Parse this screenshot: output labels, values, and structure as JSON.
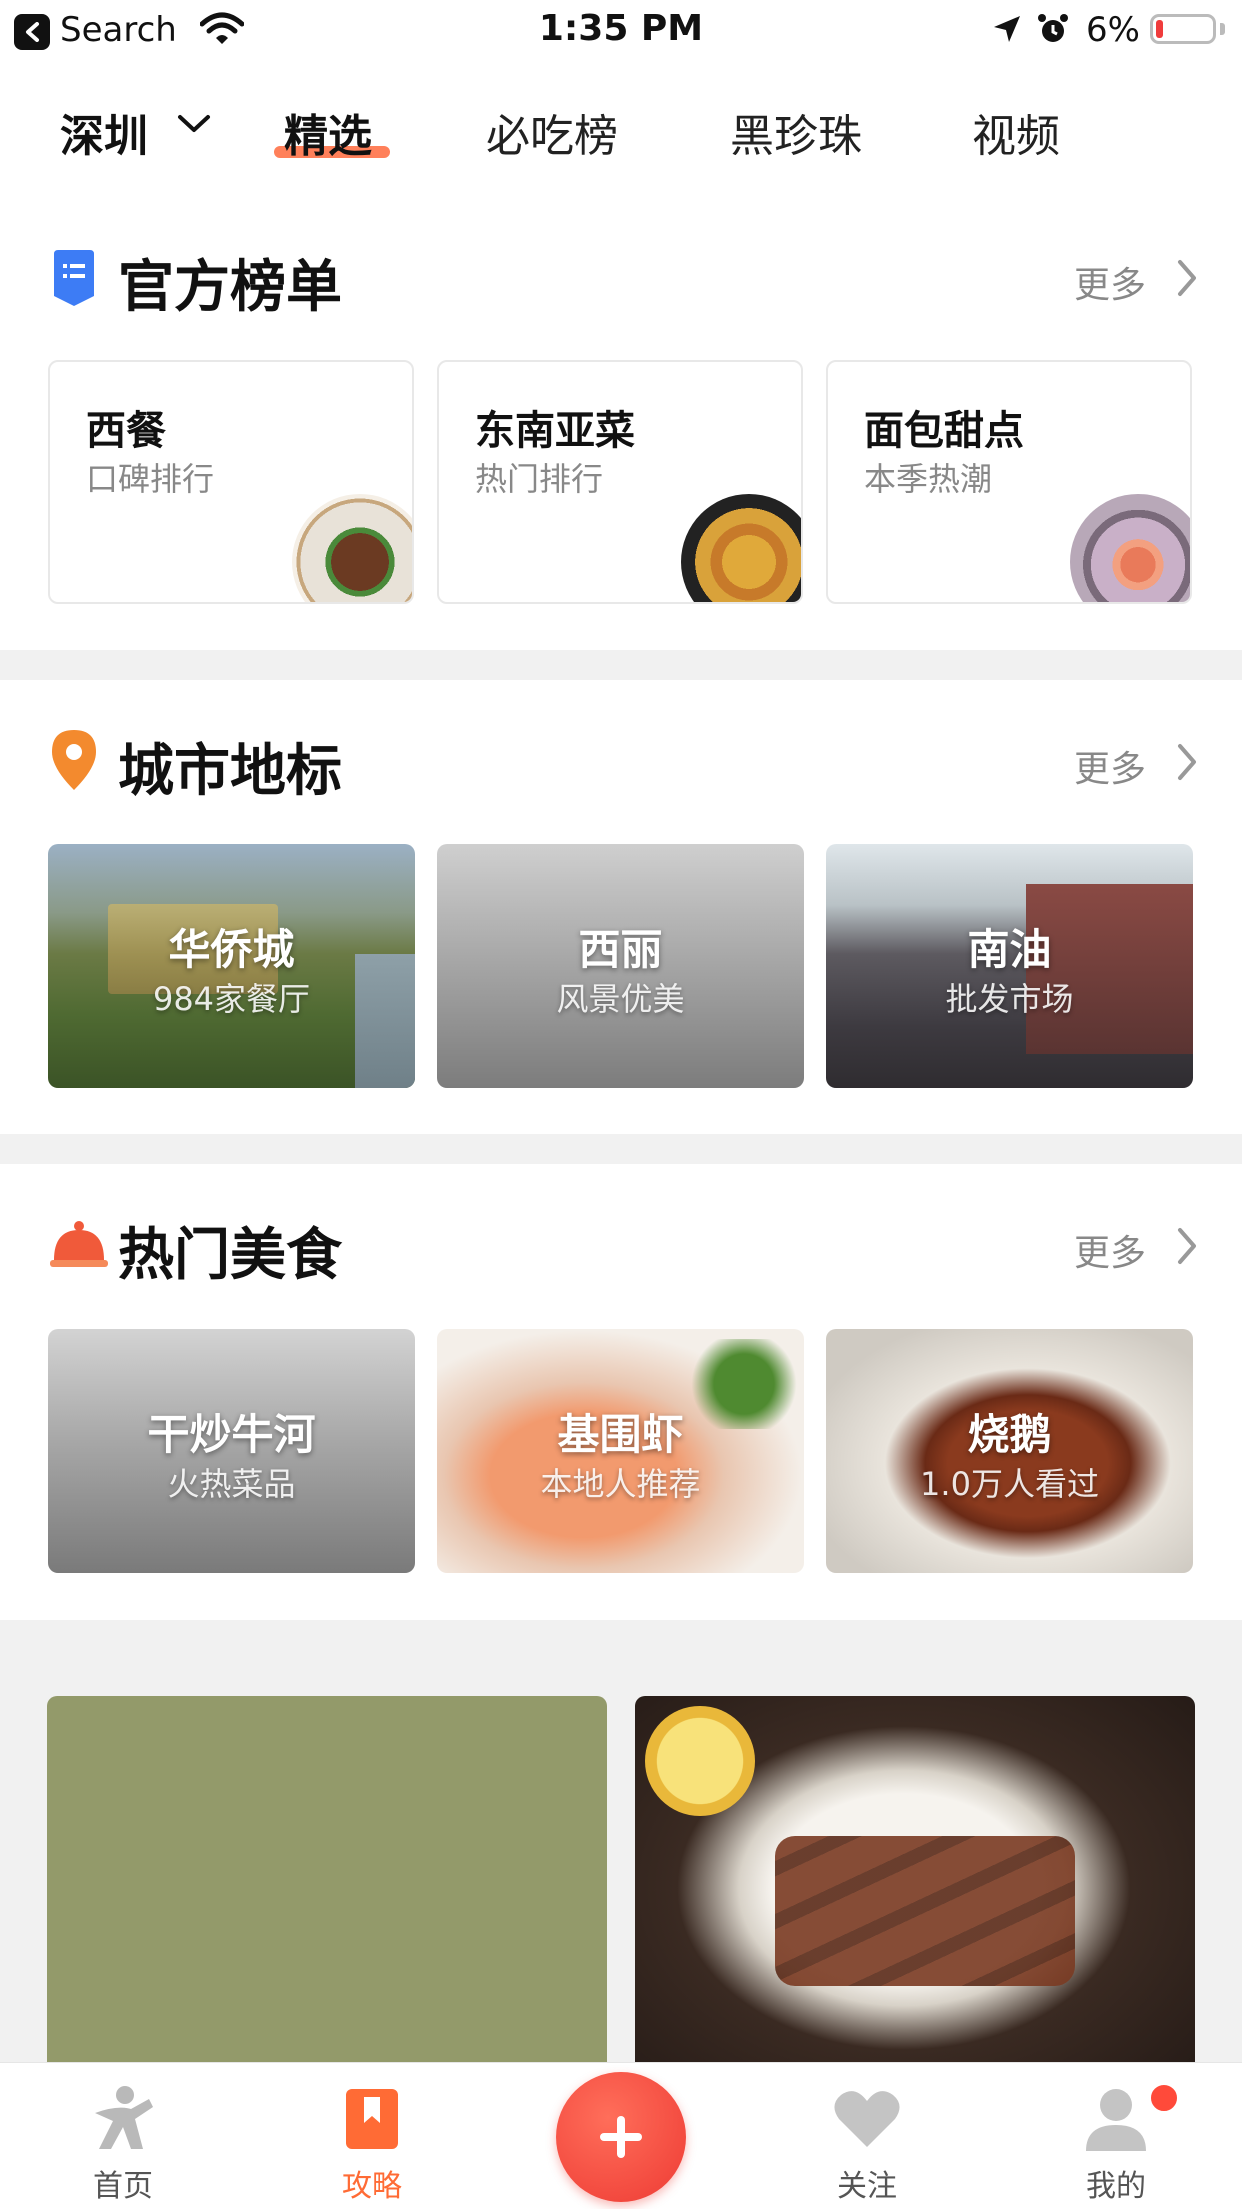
{
  "status_bar": {
    "back_label": "Search",
    "time": "1:35 PM",
    "battery_percent": "6%",
    "icons": [
      "back-arrow-icon",
      "wifi-icon",
      "location-arrow-icon",
      "alarm-icon",
      "battery-icon"
    ]
  },
  "top_nav": {
    "city": "深圳",
    "tabs": [
      {
        "label": "精选",
        "active": true
      },
      {
        "label": "必吃榜",
        "active": false
      },
      {
        "label": "黑珍珠",
        "active": false
      },
      {
        "label": "视频",
        "active": false
      }
    ]
  },
  "official_lists": {
    "title": "官方榜单",
    "more": "更多",
    "icon": "list-bookmark-icon",
    "cards": [
      {
        "title": "西餐",
        "subtitle": "口碑排行"
      },
      {
        "title": "东南亚菜",
        "subtitle": "热门排行"
      },
      {
        "title": "面包甜点",
        "subtitle": "本季热潮"
      }
    ]
  },
  "city_landmarks": {
    "title": "城市地标",
    "more": "更多",
    "icon": "location-pin-icon",
    "tiles": [
      {
        "title": "华侨城",
        "subtitle": "984家餐厅"
      },
      {
        "title": "西丽",
        "subtitle": "风景优美"
      },
      {
        "title": "南油",
        "subtitle": "批发市场"
      }
    ]
  },
  "popular_food": {
    "title": "热门美食",
    "more": "更多",
    "icon": "food-cloche-icon",
    "tiles": [
      {
        "title": "干炒牛河",
        "subtitle": "火热菜品"
      },
      {
        "title": "基围虾",
        "subtitle": "本地人推荐"
      },
      {
        "title": "烧鹅",
        "subtitle": "1.0万人看过"
      }
    ]
  },
  "tab_bar": {
    "items": [
      {
        "label": "首页",
        "icon": "home-figure-icon",
        "active": false
      },
      {
        "label": "攻略",
        "icon": "guide-bookmark-icon",
        "active": true
      },
      {
        "label": "关注",
        "icon": "heart-icon",
        "active": false
      },
      {
        "label": "我的",
        "icon": "profile-icon",
        "active": false
      }
    ],
    "plus_icon": "plus-icon"
  },
  "colors": {
    "accent": "#ff6b35",
    "plus_button": "#ee3b34",
    "divider": "#f1f1f1",
    "feed_placeholder": "#939a6a"
  }
}
